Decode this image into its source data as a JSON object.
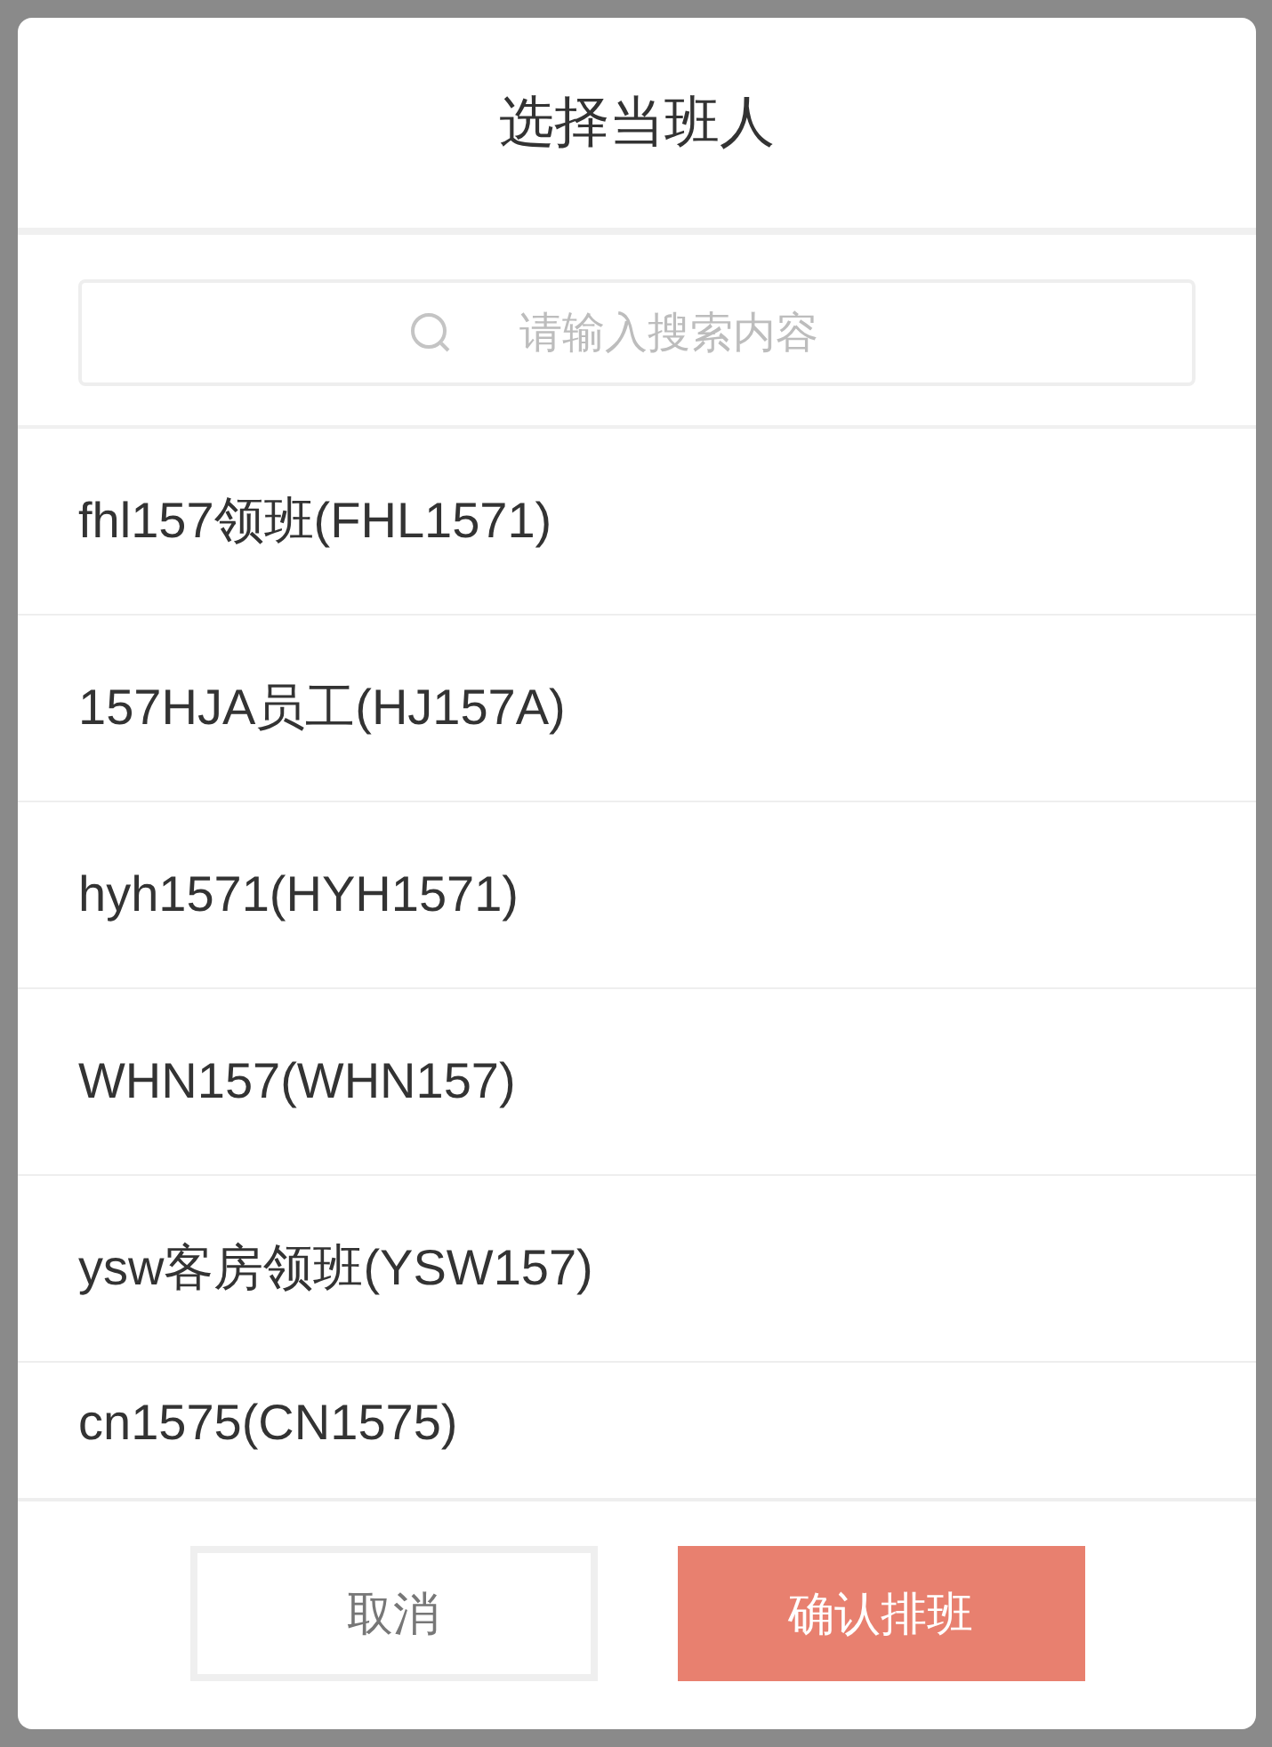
{
  "dialog": {
    "title": "选择当班人"
  },
  "search": {
    "placeholder": "请输入搜索内容"
  },
  "people": [
    {
      "label": "fhl157领班(FHL1571)"
    },
    {
      "label": "157HJA员工(HJ157A)"
    },
    {
      "label": "hyh1571(HYH1571)"
    },
    {
      "label": "WHN157(WHN157)"
    },
    {
      "label": "ysw客房领班(YSW157)"
    },
    {
      "label": "cn1575(CN1575)"
    }
  ],
  "buttons": [
    {
      "label": "取消",
      "kind": "secondary"
    },
    {
      "label": "确认排班",
      "kind": "primary"
    }
  ]
}
